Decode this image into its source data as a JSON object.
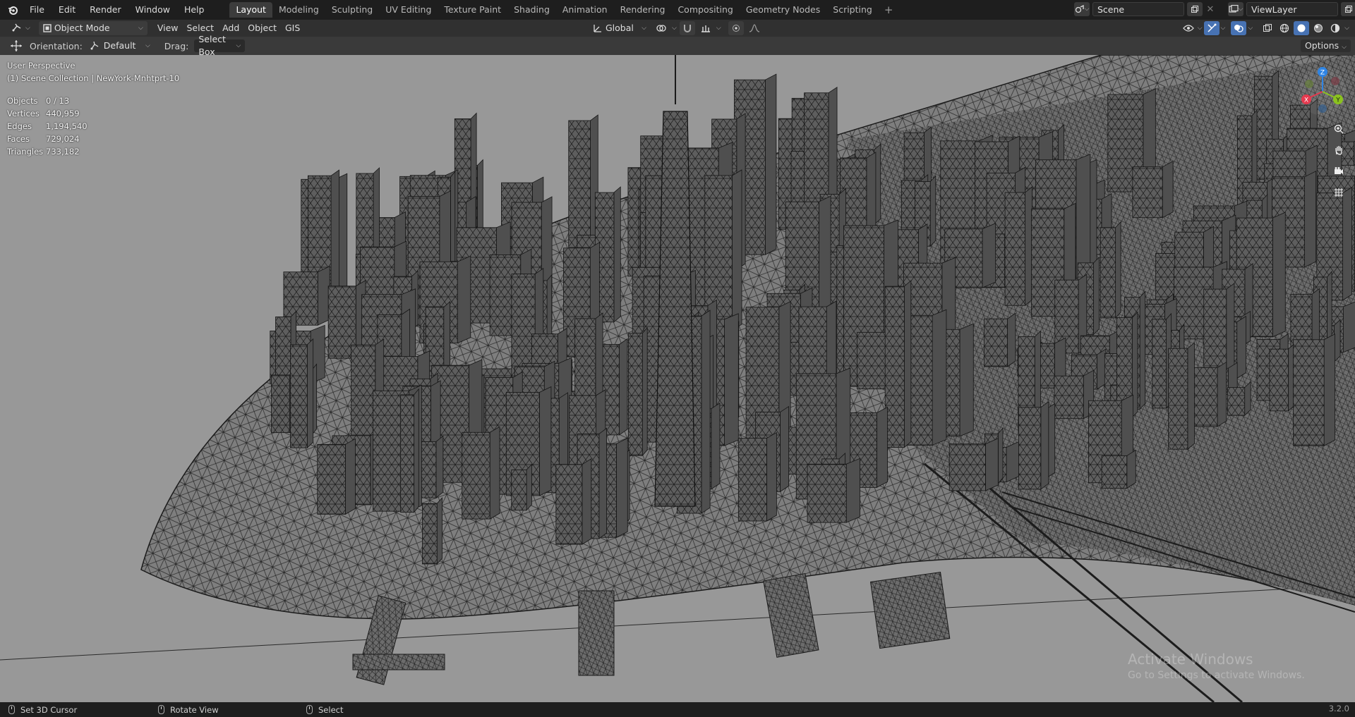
{
  "topbar": {
    "menus": [
      "File",
      "Edit",
      "Render",
      "Window",
      "Help"
    ],
    "workspace_tabs": [
      "Layout",
      "Modeling",
      "Sculpting",
      "UV Editing",
      "Texture Paint",
      "Shading",
      "Animation",
      "Rendering",
      "Compositing",
      "Geometry Nodes",
      "Scripting"
    ],
    "active_tab": "Layout",
    "add_tab_label": "+",
    "scene_name": "Scene",
    "view_layer_name": "ViewLayer"
  },
  "header": {
    "mode": "Object Mode",
    "menus": [
      "View",
      "Select",
      "Add",
      "Object",
      "GIS"
    ],
    "transform_orientation": "Global"
  },
  "tool_settings": {
    "orientation_label": "Orientation:",
    "orientation_value": "Default",
    "drag_label": "Drag:",
    "drag_value": "Select Box",
    "options_label": "Options"
  },
  "viewport": {
    "view_name": "User Perspective",
    "collection_line": "(1) Scene Collection | NewYork-Mnhtprt-10",
    "stats": [
      {
        "key": "Objects",
        "value": "0 / 13"
      },
      {
        "key": "Vertices",
        "value": "440,959"
      },
      {
        "key": "Edges",
        "value": "1,194,540"
      },
      {
        "key": "Faces",
        "value": "729,024"
      },
      {
        "key": "Triangles",
        "value": "733,182"
      }
    ],
    "gizmo_axes": {
      "x": "X",
      "y": "Y",
      "z": "Z"
    },
    "watermark_line1": "Activate Windows",
    "watermark_line2": "Go to Settings to activate Windows."
  },
  "statusbar": {
    "items": [
      "Set 3D Cursor",
      "Rotate View",
      "Select"
    ],
    "version": "3.2.0"
  },
  "colors": {
    "accent": "#4772b3",
    "axis_x": "#e53a4f",
    "axis_y": "#8bc21f",
    "axis_z": "#2f84e3",
    "viewport_bg": "#989898"
  }
}
